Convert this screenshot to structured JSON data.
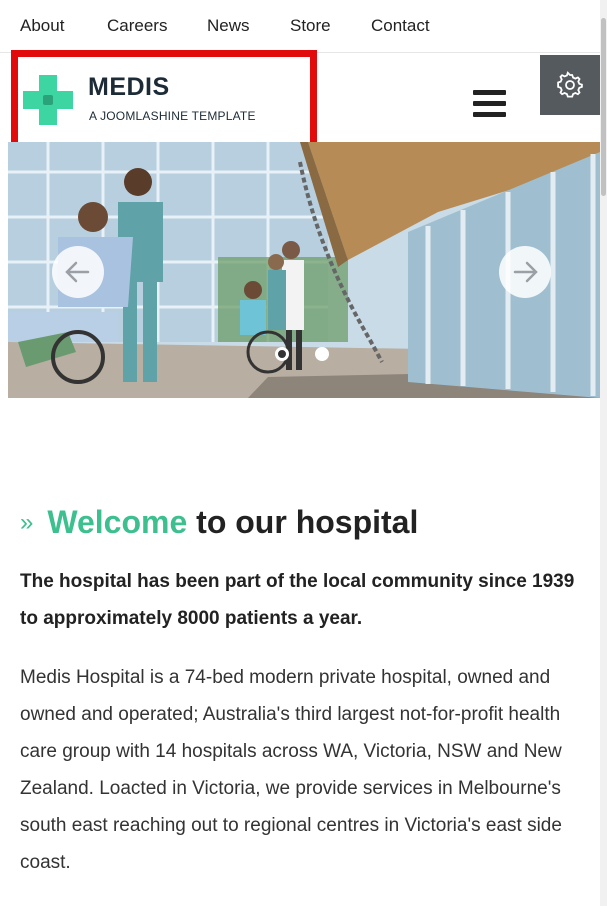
{
  "topnav": {
    "items": [
      "About",
      "Careers",
      "News",
      "Store",
      "Contact"
    ]
  },
  "header": {
    "brand": "MEDIS",
    "tagline": "A JOOMLASHINE TEMPLATE",
    "menu_icon": "hamburger-icon",
    "settings_icon": "gear-icon"
  },
  "slider": {
    "prev_icon": "arrow-left-icon",
    "next_icon": "arrow-right-icon",
    "active_slide": 1,
    "slide_count": 2
  },
  "content": {
    "heading_accent": "Welcome",
    "heading_rest": "to our hospital",
    "chevron": "»",
    "lead": "The hospital has been part of the local community since 1939 to approximately 8000 patients a year.",
    "body": "Medis Hospital is a 74-bed modern private hospital, owned and owned and operated; Australia's third largest not-for-profit health care group with 14 hospitals across WA, Victoria, NSW and New Zealand. Loacted in Victoria, we provide services in Melbourne's south east reaching out to regional centres in Victoria's east side coast."
  },
  "colors": {
    "accent": "#3dbf8f",
    "highlight_box": "#e10b0b",
    "settings_bg": "#555a5f"
  }
}
